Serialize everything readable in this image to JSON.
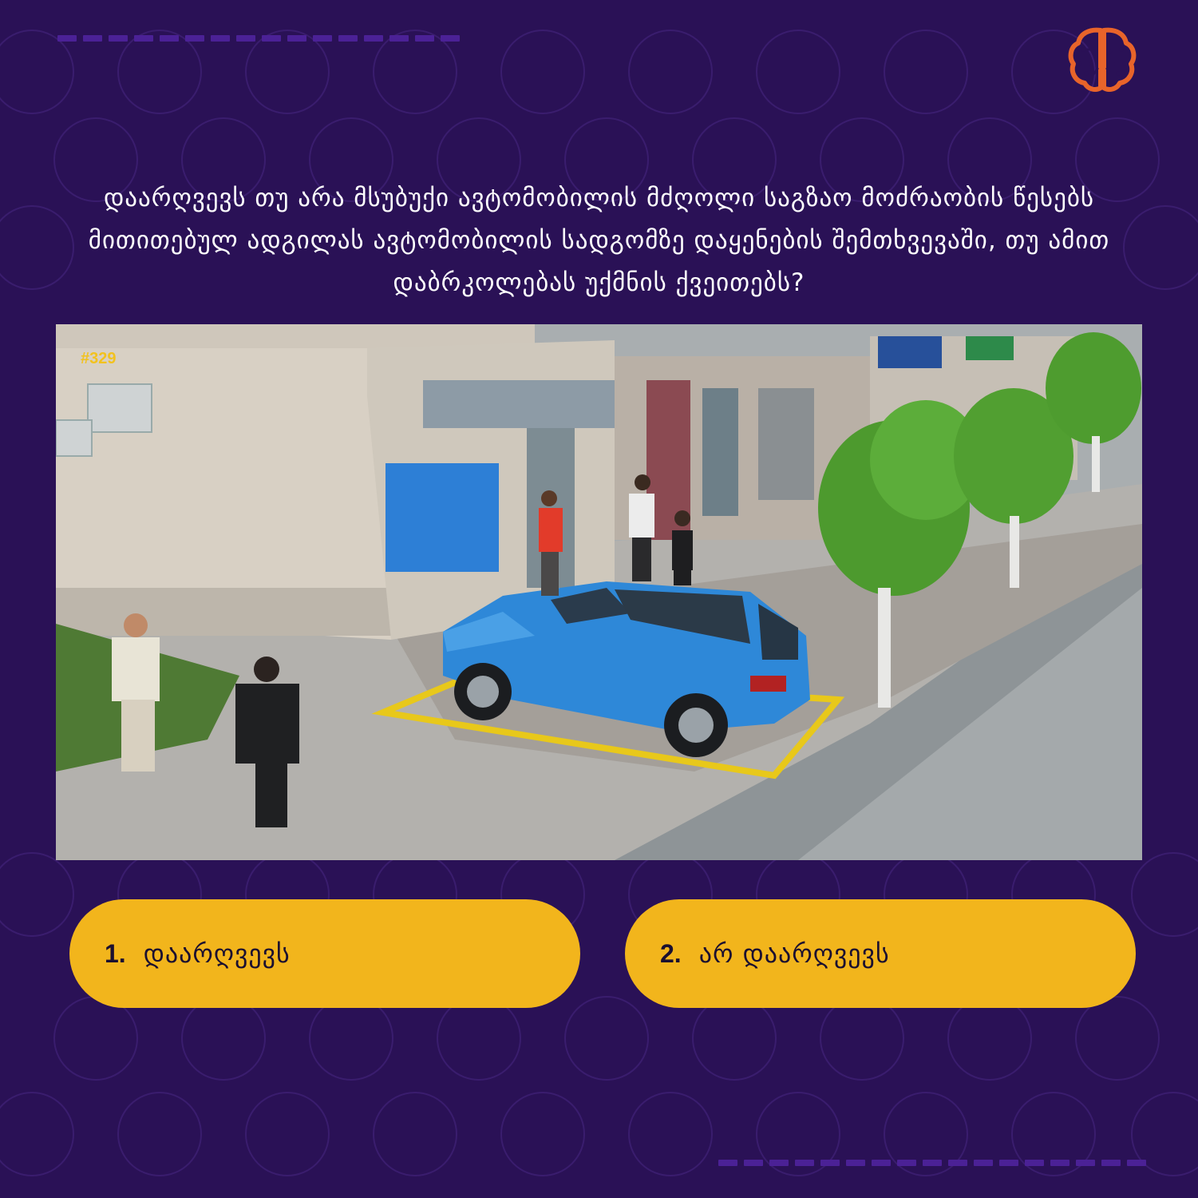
{
  "question": {
    "text": "დაარღვევს თუ არა მსუბუქი ავტომობილის მძღოლი საგზაო მოძრაობის წესებს მითითებულ ადგილას ავტომობილის სადგომზე დაყენების შემთხვევაში, თუ ამით დაბრკოლებას უქმნის ქვეითებს?"
  },
  "scene": {
    "question_number": "#329"
  },
  "answers": [
    {
      "number": "1.",
      "label": "დაარღვევს"
    },
    {
      "number": "2.",
      "label": "არ დაარღვევს"
    }
  ],
  "colors": {
    "background": "#2a1156",
    "accent_yellow": "#f2b51c",
    "logo_orange": "#e8642a",
    "dash_purple": "#4b2196"
  },
  "icons": {
    "logo": "brain-circuit-icon"
  }
}
